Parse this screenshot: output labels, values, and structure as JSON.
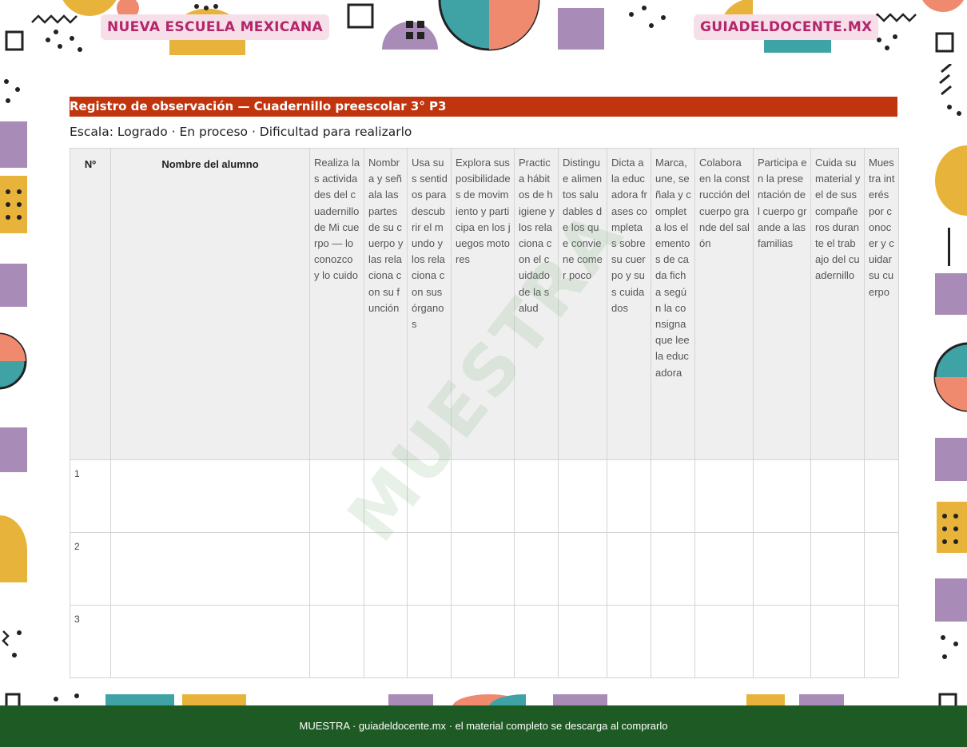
{
  "header": {
    "badge_left": "NUEVA ESCUELA MEXICANA",
    "badge_right": "GUIADELDOCENTE.MX"
  },
  "document": {
    "title": "Registro de observación — Cuadernillo preescolar 3° P3",
    "scale_line": "Escala: Logrado · En proceso · Dificultad para realizarlo"
  },
  "table": {
    "col_number": "Nº",
    "col_name": "Nombre del alumno",
    "criteria": [
      "Realiza las actividades del cuadernillo de Mi cuerpo — lo conozco y lo cuido",
      "Nombra y señala las partes de su cuerpo y las relaciona con su función",
      "Usa sus sentidos para descubrir el mundo y los relaciona con sus órganos",
      "Explora sus posibilidades de movimiento y participa en los juegos motores",
      "Practica hábitos de higiene y los relaciona con el cuidado de la salud",
      "Distingue alimentos saludables de los que conviene comer poco",
      "Dicta a la educadora frases completas sobre su cuerpo y sus cuidados",
      "Marca, une, señala y completa los elementos de cada ficha según la consigna que lee la educadora",
      "Colabora en la construcción del cuerpo grande del salón",
      "Participa en la presentación del cuerpo grande a las familias",
      "Cuida su material y el de sus compañeros durante el trabajo del cuadernillo",
      "Muestra interés por conocer y cuidar su cuerpo"
    ],
    "rows": [
      {
        "number": "1"
      },
      {
        "number": "2"
      },
      {
        "number": "3"
      }
    ]
  },
  "watermark": "MUESTRA",
  "footer": {
    "text": "MUESTRA · guiadeldocente.mx · el material completo se descarga al comprarlo"
  },
  "colors": {
    "title_bar": "#c0350e",
    "footer_bg": "#1e5a23",
    "badge_bg": "#f7dfe9",
    "badge_text": "#b3266a",
    "header_cell_bg": "#efefef"
  }
}
